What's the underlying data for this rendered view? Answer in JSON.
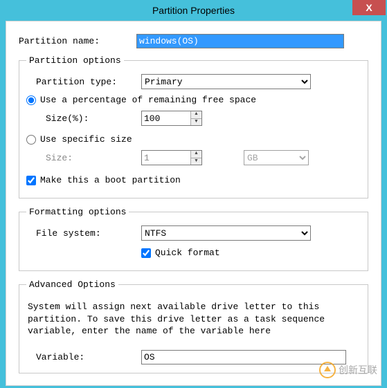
{
  "titlebar": {
    "title": "Partition Properties",
    "close_glyph": "X"
  },
  "form": {
    "name_label": "Partition name:",
    "name_value": "windows(OS)"
  },
  "options": {
    "legend": "Partition options",
    "type_label": "Partition type:",
    "type_value": "Primary",
    "use_percent_label": "Use a percentage of remaining free space",
    "size_percent_label": "Size(%):",
    "size_percent_value": "100",
    "use_specific_label": "Use specific size",
    "size_label": "Size:",
    "size_value": "1",
    "size_unit": "GB",
    "boot_label": "Make this a boot partition"
  },
  "formatting": {
    "legend": "Formatting options",
    "fs_label": "File system:",
    "fs_value": "NTFS",
    "quick_label": "Quick format"
  },
  "advanced": {
    "legend": "Advanced Options",
    "help_text": "System will assign next available drive letter to this partition. To save this drive letter as a task sequence variable, enter the name of the variable here",
    "var_label": "Variable:",
    "var_value": "OS"
  },
  "watermark": {
    "text": "创新互联",
    "sub": ""
  }
}
